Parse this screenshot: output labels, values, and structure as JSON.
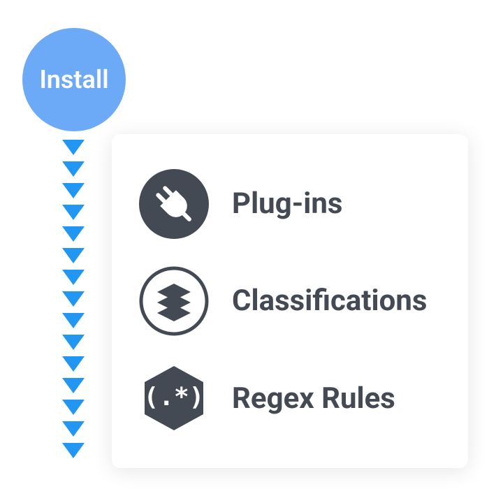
{
  "install": {
    "label": "Install"
  },
  "items": [
    {
      "label": "Plug-ins",
      "icon": "plug-icon"
    },
    {
      "label": "Classifications",
      "icon": "layers-icon"
    },
    {
      "label": "Regex Rules",
      "icon": "regex-icon"
    }
  ],
  "colors": {
    "accent_blue": "#2196f3",
    "circle_blue": "#6ca9f6",
    "dark": "#444a54"
  }
}
